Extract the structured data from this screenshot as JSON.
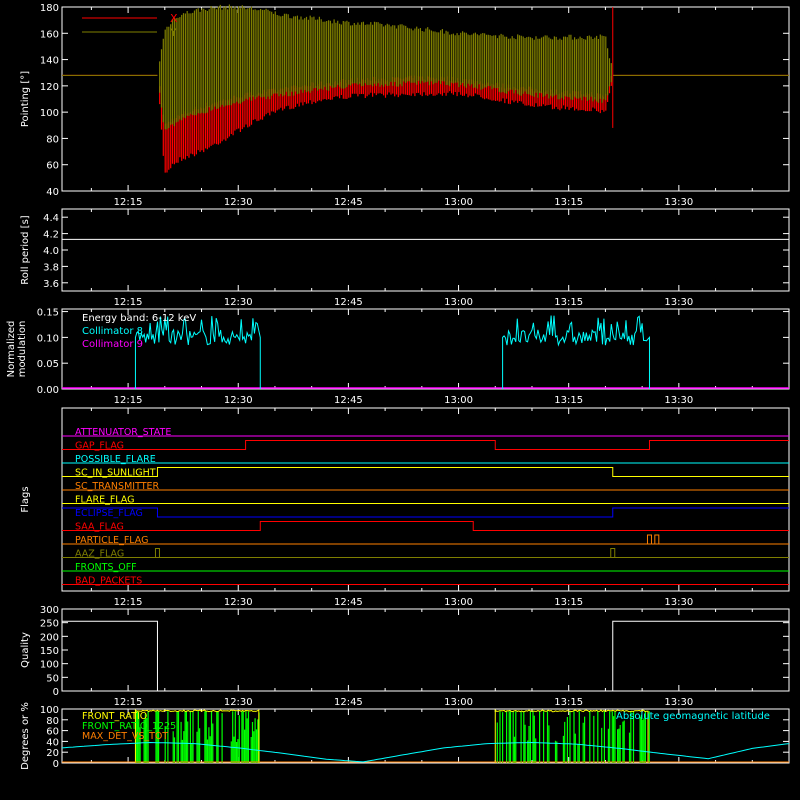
{
  "colors": {
    "background": "#000000",
    "axes": "#ffffff",
    "x_red": "#ff0000",
    "y_olive": "#7f7f00",
    "cyan": "#00ffff",
    "magenta": "#ff00ff",
    "yellow": "#ffff00",
    "green": "#00ff00",
    "orange": "#ff7f00"
  },
  "time_ticks": [
    "12:15",
    "12:30",
    "12:45",
    "13:00",
    "13:15",
    "13:30"
  ],
  "chart_data": [
    {
      "id": "pointing",
      "type": "line",
      "ylabel": "Pointing [°]",
      "ylim": [
        40,
        180
      ],
      "yticks": [
        "40",
        "60",
        "80",
        "100",
        "120",
        "140",
        "160",
        "180"
      ],
      "x_range": [
        "12:06",
        "13:45"
      ],
      "legend": "top-left",
      "series": [
        {
          "name": "X",
          "color": "#ff0000",
          "x": [
            "12:06",
            "12:19",
            "12:20",
            "12:21",
            "12:22",
            "12:24",
            "12:26",
            "12:28",
            "12:30",
            "12:33",
            "12:36",
            "12:39",
            "12:42",
            "12:45",
            "12:48",
            "12:51",
            "12:54",
            "12:57",
            "13:00",
            "13:03",
            "13:06",
            "13:09",
            "13:12",
            "13:15",
            "13:18",
            "13:20",
            "13:21",
            "13:45"
          ],
          "y_low": [
            128,
            128,
            55,
            62,
            66,
            70,
            75,
            81,
            88,
            97,
            104,
            109,
            112,
            114,
            115,
            115,
            116,
            116,
            116,
            114,
            111,
            108,
            106,
            105,
            104,
            102,
            128,
            128
          ],
          "y_high": [
            128,
            128,
            88,
            92,
            95,
            100,
            104,
            107,
            110,
            113,
            115,
            118,
            120,
            122,
            123,
            123,
            124,
            124,
            123,
            121,
            118,
            116,
            114,
            113,
            112,
            110,
            128,
            128
          ]
        },
        {
          "name": "Y",
          "color": "#7f7f00",
          "x": [
            "12:06",
            "12:19",
            "12:20",
            "12:21",
            "12:22",
            "12:24",
            "12:26",
            "12:28",
            "12:30",
            "12:33",
            "12:36",
            "12:39",
            "12:42",
            "12:45",
            "12:48",
            "12:51",
            "12:54",
            "12:57",
            "13:00",
            "13:03",
            "13:06",
            "13:09",
            "13:12",
            "13:15",
            "13:18",
            "13:20",
            "13:21",
            "13:45"
          ],
          "y_low": [
            128,
            128,
            88,
            92,
            95,
            100,
            104,
            107,
            110,
            113,
            115,
            118,
            120,
            122,
            123,
            123,
            124,
            124,
            123,
            121,
            118,
            116,
            114,
            113,
            112,
            110,
            128,
            128
          ],
          "y_high": [
            128,
            128,
            160,
            168,
            172,
            175,
            177,
            178,
            178,
            176,
            172,
            170,
            168,
            166,
            165,
            164,
            162,
            160,
            158,
            157,
            156,
            155,
            155,
            155,
            155,
            156,
            128,
            128
          ]
        }
      ]
    },
    {
      "id": "roll",
      "type": "line",
      "ylabel": "Roll period [s]",
      "ylim": [
        3.5,
        4.5
      ],
      "yticks": [
        "3.6",
        "3.8",
        "4.0",
        "4.2",
        "4.4"
      ],
      "series": [
        {
          "color": "#ffffff",
          "x": [
            "12:06",
            "13:45"
          ],
          "y": [
            4.13,
            4.13
          ]
        }
      ]
    },
    {
      "id": "modulation",
      "type": "line",
      "ylabel": "Normalized\nmodulation",
      "ylim": [
        0,
        0.155
      ],
      "yticks": [
        "0.00",
        "0.05",
        "0.10",
        "0.15"
      ],
      "annotation": "Energy band: 6-12 keV",
      "series": [
        {
          "name": "Collimator 8",
          "color": "#00ffff",
          "intervals": [
            {
              "start": "12:16",
              "end": "12:33"
            },
            {
              "start": "13:06",
              "end": "13:26"
            }
          ],
          "mean": 0.1,
          "min": 0.085,
          "max": 0.145
        },
        {
          "name": "Collimator 9",
          "color": "#ff00ff",
          "x": [
            "12:06",
            "13:45"
          ],
          "y": [
            0,
            0
          ]
        }
      ]
    },
    {
      "id": "flags",
      "type": "line",
      "ylabel": "Flags",
      "flags": [
        {
          "name": "ATTENUATOR_STATE",
          "color": "#ff00ff",
          "changes": [],
          "base": 0
        },
        {
          "name": "GAP_FLAG",
          "color": "#ff0000",
          "changes": [
            [
              "12:31",
              1
            ],
            [
              "13:05",
              0
            ],
            [
              "13:26",
              1
            ]
          ],
          "base": 0
        },
        {
          "name": "POSSIBLE_FLARE",
          "color": "#00ffff",
          "changes": [],
          "base": 0
        },
        {
          "name": "SC_IN_SUNLIGHT",
          "color": "#ffff00",
          "changes": [
            [
              "12:19",
              1
            ],
            [
              "13:21",
              0
            ]
          ],
          "base": 0
        },
        {
          "name": "SC_TRANSMITTER",
          "color": "#ff7f00",
          "changes": [],
          "base": 0
        },
        {
          "name": "FLARE_FLAG",
          "color": "#ffff00",
          "changes": [],
          "base": 0
        },
        {
          "name": "ECLIPSE_FLAG",
          "color": "#0000ff",
          "changes": [
            [
              "12:19",
              0
            ],
            [
              "13:21",
              1
            ]
          ],
          "base": 1
        },
        {
          "name": "SAA_FLAG",
          "color": "#ff0000",
          "changes": [
            [
              "12:33",
              1
            ],
            [
              "12:62",
              0
            ]
          ],
          "base": 0
        },
        {
          "name": "PARTICLE_FLAG",
          "color": "#ff7f00",
          "spikes": [
            "13:26",
            "13:27"
          ],
          "base": 0
        },
        {
          "name": "AAZ_FLAG",
          "color": "#7f7f00",
          "spikes": [
            "12:19",
            "13:21"
          ],
          "base": 0
        },
        {
          "name": "FRONTS_OFF",
          "color": "#00ff00",
          "changes": [],
          "base": 0
        },
        {
          "name": "BAD_PACKETS",
          "color": "#ff0000",
          "changes": [],
          "base": 0
        }
      ]
    },
    {
      "id": "quality",
      "type": "line",
      "ylabel": "Quality",
      "ylim": [
        0,
        300
      ],
      "yticks": [
        "0",
        "50",
        "100",
        "150",
        "200",
        "250",
        "300"
      ],
      "series": [
        {
          "color": "#ffffff",
          "x": [
            "12:06",
            "12:19",
            "12:19",
            "13:21",
            "13:21",
            "13:45"
          ],
          "y": [
            255,
            255,
            0,
            0,
            255,
            255
          ]
        }
      ]
    },
    {
      "id": "ratios",
      "type": "line",
      "ylabel": "Degrees or %",
      "ylim": [
        0,
        100
      ],
      "yticks": [
        "0",
        "20",
        "40",
        "60",
        "80",
        "100"
      ],
      "legend": "top-left",
      "series": [
        {
          "name": "FRONT_RATIO",
          "color": "#ffff00",
          "intervals": [
            {
              "start": "12:16",
              "end": "12:33"
            },
            {
              "start": "13:05",
              "end": "13:26"
            }
          ],
          "level": 98
        },
        {
          "name": "FRONT_RATIO_1225",
          "color": "#00ff00",
          "intervals": [
            {
              "start": "12:16",
              "end": "12:33"
            },
            {
              "start": "13:05",
              "end": "13:26"
            }
          ],
          "min": 0,
          "max": 96
        },
        {
          "name": "MAX_DET_VS_TOT",
          "color": "#ff7f00",
          "x": [
            "12:06",
            "13:45"
          ],
          "y": [
            0,
            0
          ]
        },
        {
          "name": "Absolute geomagnetic latitude",
          "color": "#00ffff",
          "x": [
            "12:06",
            "12:12",
            "12:18",
            "12:24",
            "12:30",
            "12:36",
            "12:42",
            "12:47",
            "12:52",
            "12:58",
            "13:04",
            "13:10",
            "13:16",
            "13:22",
            "13:28",
            "13:34",
            "13:40",
            "13:45"
          ],
          "y": [
            28,
            34,
            38,
            36,
            28,
            18,
            7,
            2,
            14,
            28,
            36,
            38,
            35,
            27,
            17,
            8,
            27,
            36
          ]
        }
      ]
    }
  ]
}
